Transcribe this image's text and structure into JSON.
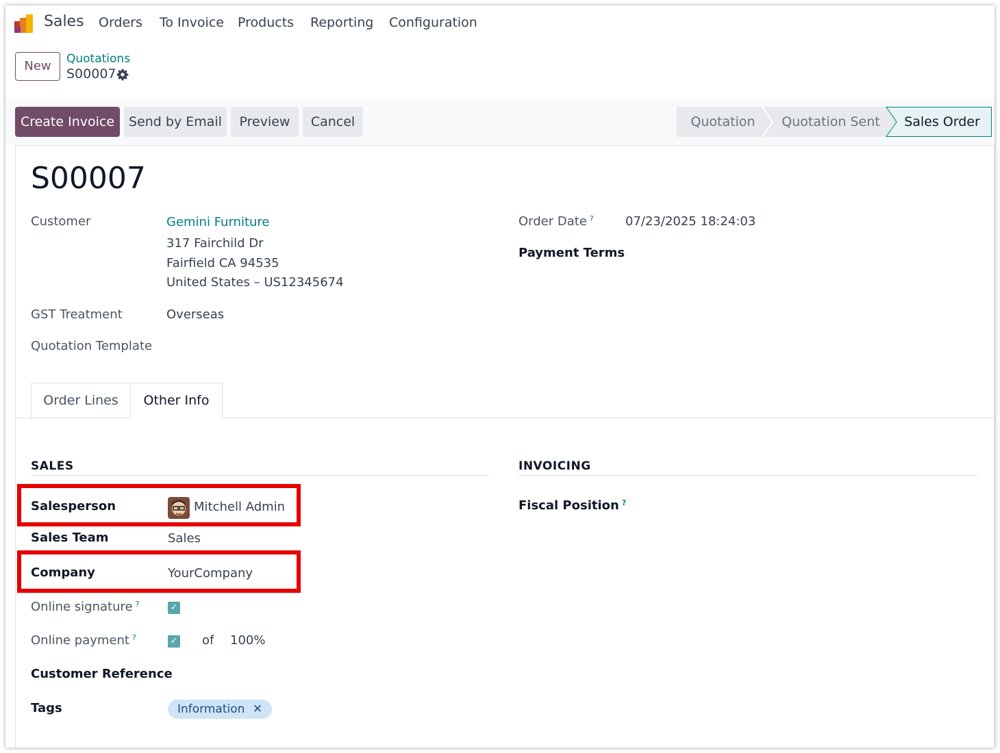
{
  "nav": {
    "app_name": "Sales",
    "items": [
      "Orders",
      "To Invoice",
      "Products",
      "Reporting",
      "Configuration"
    ]
  },
  "control": {
    "new_label": "New",
    "breadcrumb_parent": "Quotations",
    "breadcrumb_current": "S00007"
  },
  "actions": {
    "create_invoice": "Create Invoice",
    "send_email": "Send by Email",
    "preview": "Preview",
    "cancel": "Cancel"
  },
  "status": {
    "steps": [
      "Quotation",
      "Quotation Sent",
      "Sales Order"
    ],
    "current": "Sales Order"
  },
  "form": {
    "title": "S00007",
    "customer_label": "Customer",
    "customer_name": "Gemini Furniture",
    "address_line1": "317 Fairchild Dr",
    "address_line2": "Fairfield CA 94535",
    "address_line3": "United States – US12345674",
    "gst_label": "GST Treatment",
    "gst_value": "Overseas",
    "template_label": "Quotation Template",
    "order_date_label": "Order Date",
    "order_date_help": "?",
    "order_date_value": "07/23/2025 18:24:03",
    "payment_terms_label": "Payment Terms"
  },
  "tabs": {
    "order_lines": "Order Lines",
    "other_info": "Other Info"
  },
  "other_info": {
    "sales_section": "SALES",
    "invoicing_section": "INVOICING",
    "salesperson_label": "Salesperson",
    "salesperson_value": "Mitchell Admin",
    "sales_team_label": "Sales Team",
    "sales_team_value": "Sales",
    "company_label": "Company",
    "company_value": "YourCompany",
    "online_signature_label": "Online signature",
    "online_payment_label": "Online payment",
    "of_label": "of",
    "payment_percent": "100%",
    "customer_ref_label": "Customer Reference",
    "tags_label": "Tags",
    "tag_value": "Information",
    "fiscal_position_label": "Fiscal Position",
    "help_mark": "?"
  },
  "colors": {
    "primary": "#714b67",
    "link": "#017e84",
    "highlight": "#e60000",
    "checkbox": "#5aa6ab",
    "tag_bg": "#cfe4f7"
  }
}
